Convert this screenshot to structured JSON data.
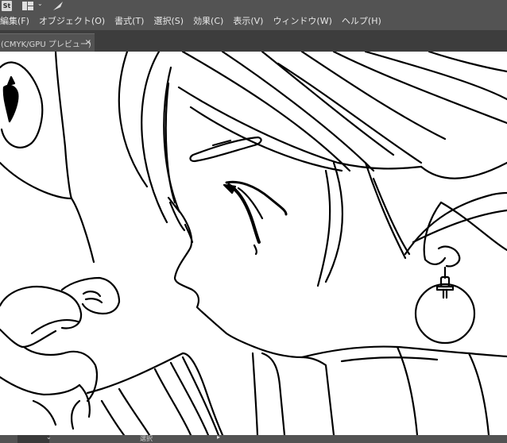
{
  "app": {
    "logo": "St",
    "icons": [
      "workspace-layout-icon",
      "chevron-down-icon",
      "feather-publish-icon"
    ]
  },
  "menu": {
    "items": [
      {
        "label": "編集(F)"
      },
      {
        "label": "オブジェクト(O)"
      },
      {
        "label": "書式(T)"
      },
      {
        "label": "選択(S)"
      },
      {
        "label": "効果(C)"
      },
      {
        "label": "表示(V)"
      },
      {
        "label": "ウィンドウ(W)"
      },
      {
        "label": "ヘルプ(H)"
      }
    ]
  },
  "tab": {
    "label": "(CMYK/GPU プレビュー)",
    "close": "×"
  },
  "status": {
    "mode": "選択",
    "chevron": "⌄",
    "arrow": "▸"
  },
  "colors": {
    "chrome": "#535353",
    "tabbar": "#3d3d3d",
    "canvas": "#ffffff",
    "line": "#000000"
  }
}
